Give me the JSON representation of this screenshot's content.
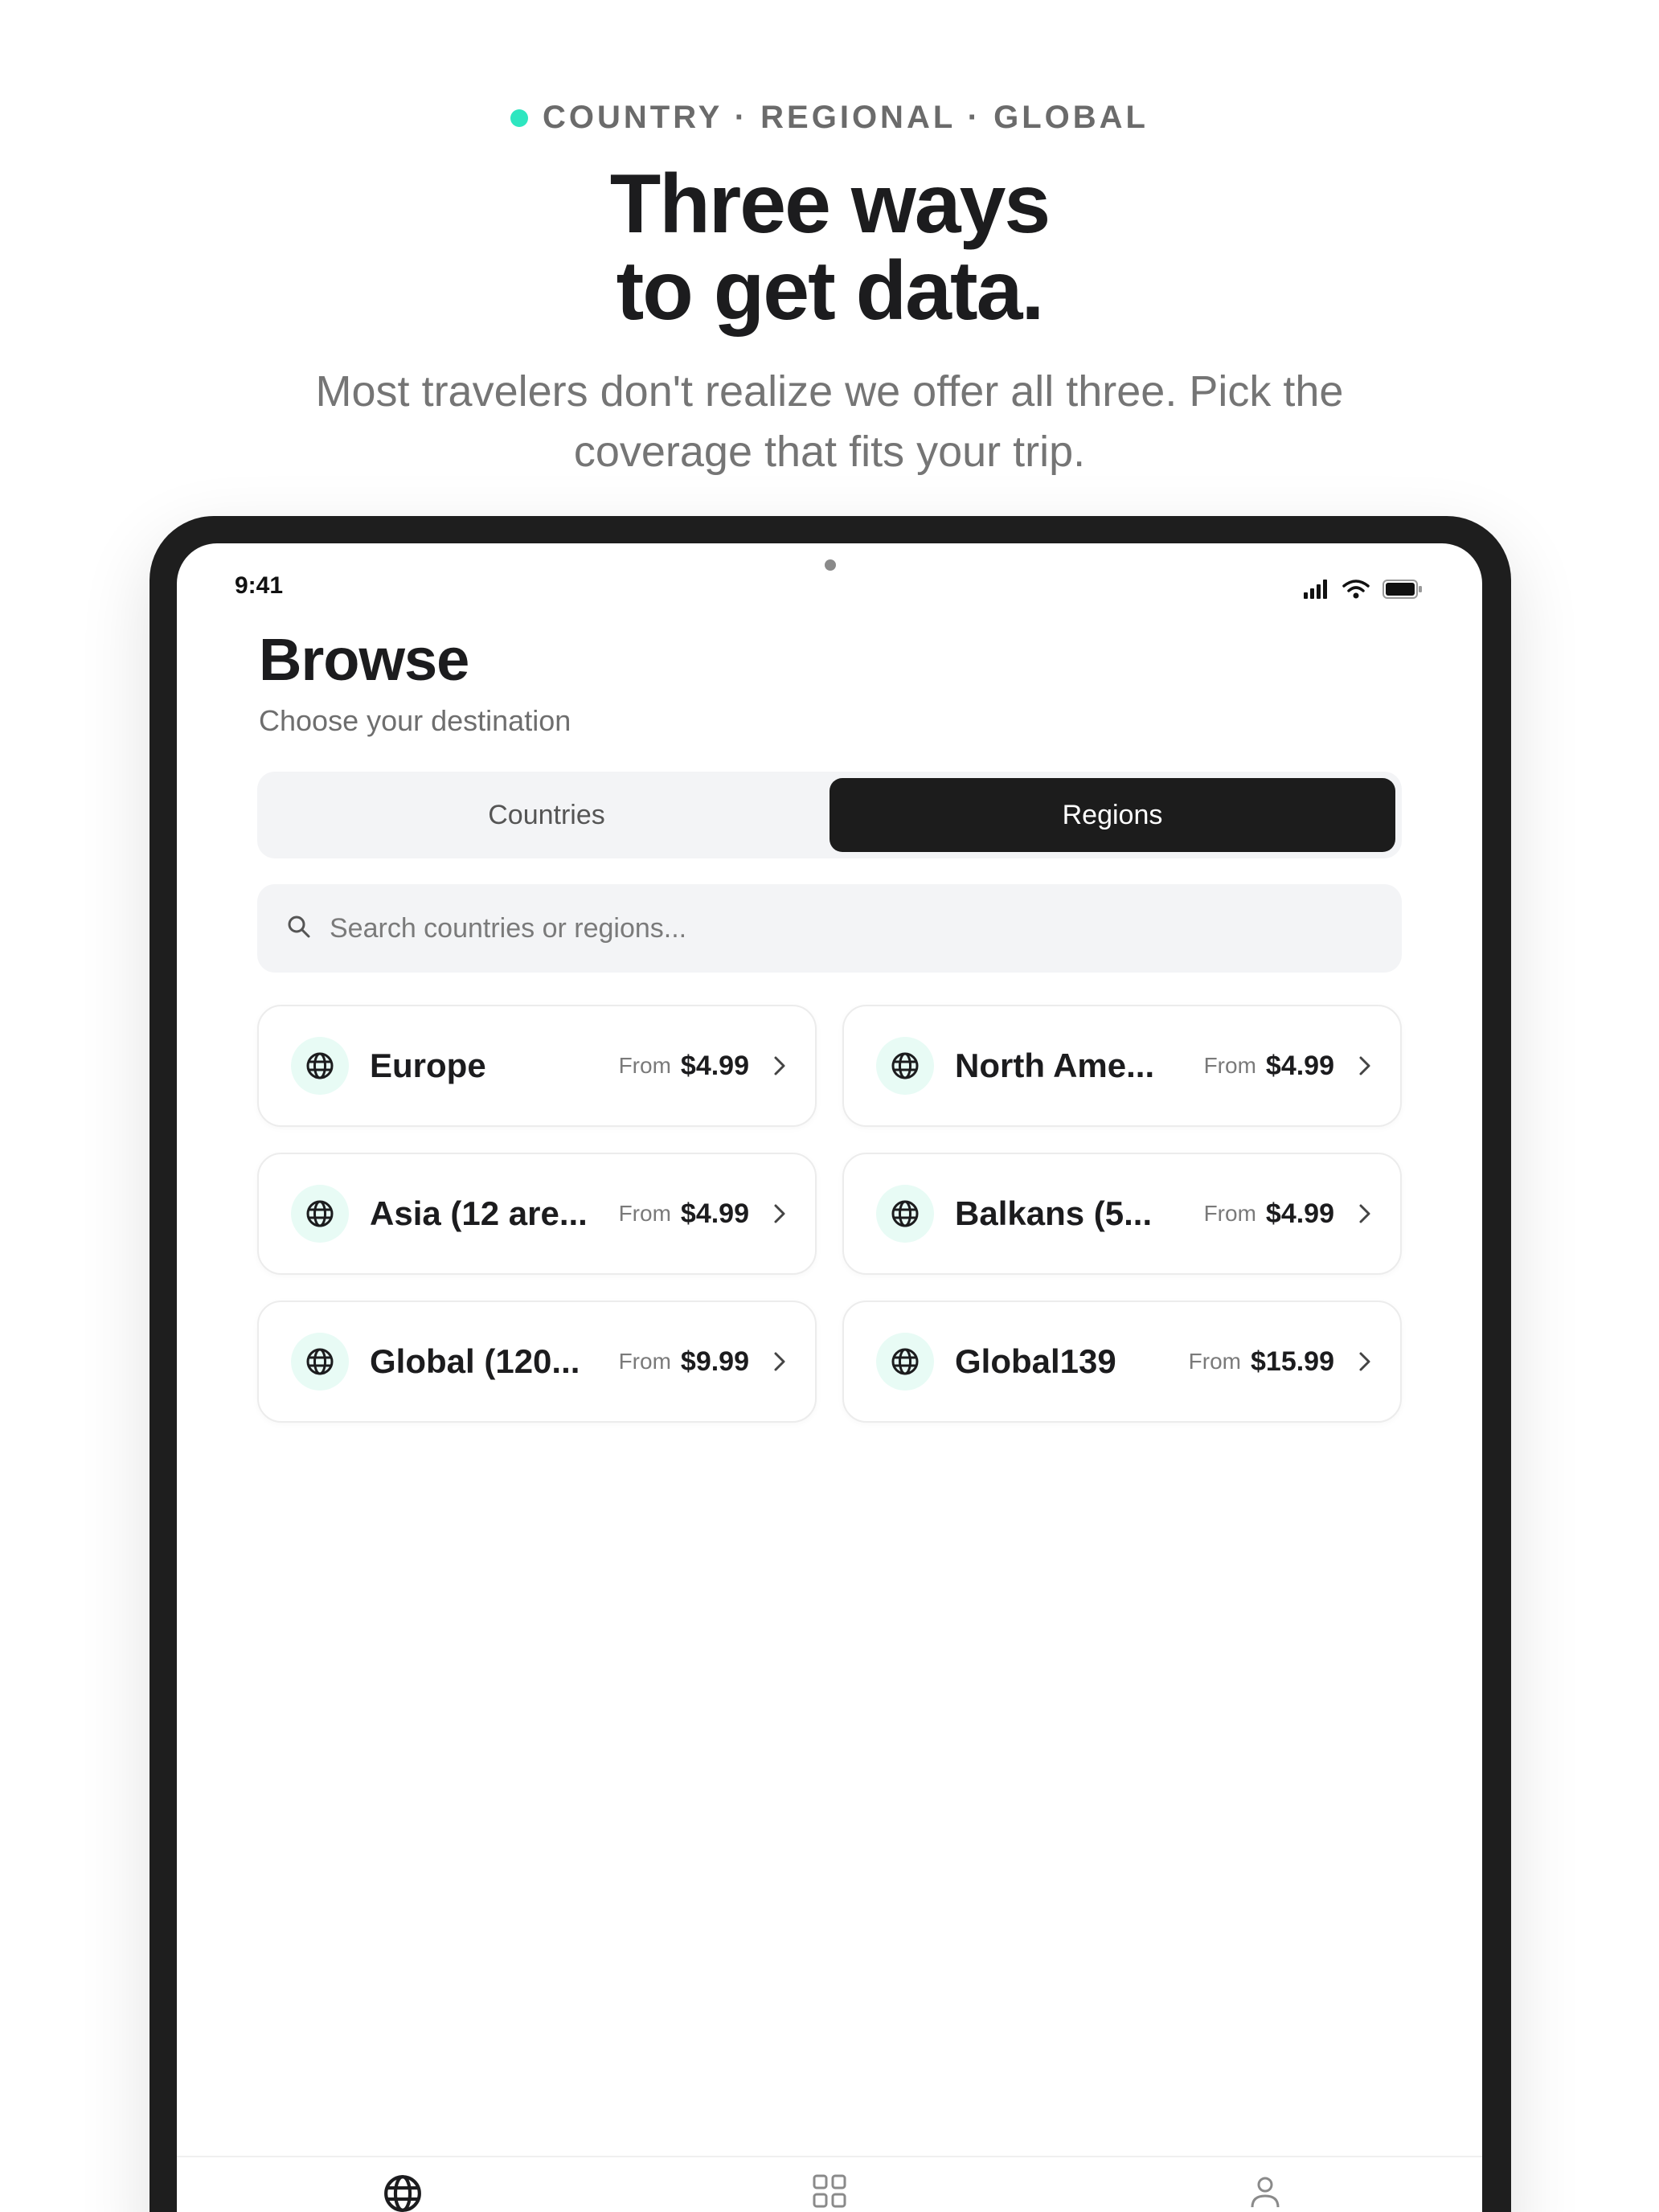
{
  "marketing": {
    "eyebrow": "COUNTRY · REGIONAL · GLOBAL",
    "headline_line1": "Three ways",
    "headline_line2": "to get data.",
    "subhead": "Most travelers don't realize we offer all three. Pick the coverage that fits your trip."
  },
  "status_bar": {
    "time": "9:41",
    "icons": [
      "signal-icon",
      "wifi-icon",
      "battery-icon"
    ]
  },
  "browse": {
    "title": "Browse",
    "subtitle": "Choose your destination",
    "tabs": [
      {
        "label": "Countries",
        "active": false
      },
      {
        "label": "Regions",
        "active": true
      }
    ],
    "search_placeholder": "Search countries or regions...",
    "regions": [
      {
        "name": "Europe",
        "from_label": "From",
        "price": "$4.99"
      },
      {
        "name": "North Ame...",
        "from_label": "From",
        "price": "$4.99"
      },
      {
        "name": "Asia (12 are...",
        "from_label": "From",
        "price": "$4.99"
      },
      {
        "name": "Balkans (5...",
        "from_label": "From",
        "price": "$4.99"
      },
      {
        "name": "Global (120...",
        "from_label": "From",
        "price": "$9.99"
      },
      {
        "name": "Global139",
        "from_label": "From",
        "price": "$15.99"
      }
    ]
  },
  "tab_bar": {
    "items": [
      "globe-icon",
      "grid-icon",
      "profile-icon"
    ]
  },
  "colors": {
    "accent": "#2ee6c0",
    "globe_bg": "#e8fbf5",
    "active_tab": "#1c1c1c",
    "device_frame": "#1e1e1e"
  }
}
